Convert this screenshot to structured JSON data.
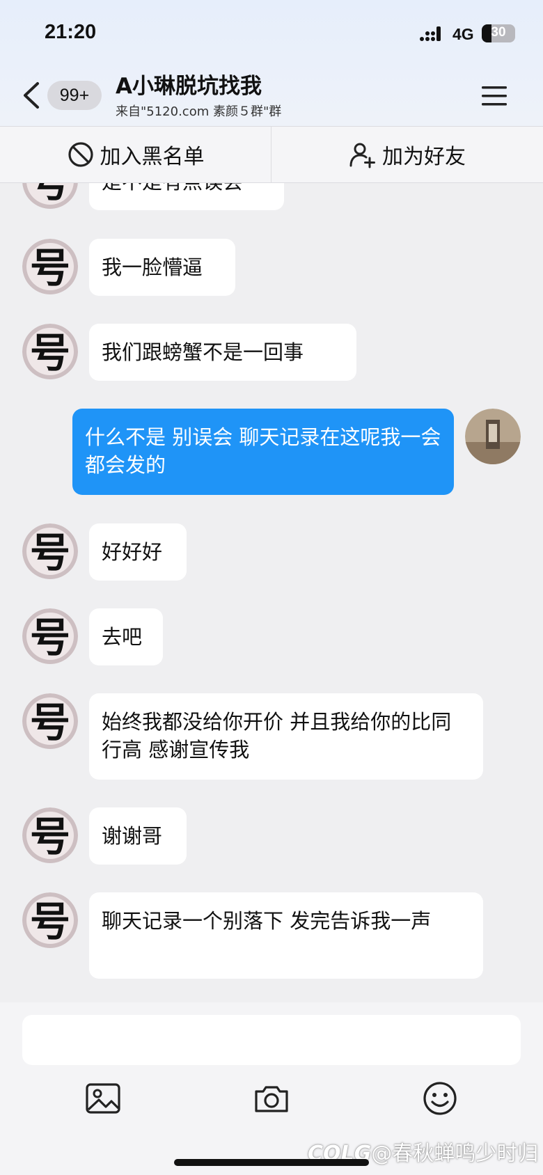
{
  "status_bar": {
    "time": "21:20",
    "network": "4G",
    "battery_level": "30",
    "battery_fraction": 0.3
  },
  "header": {
    "back_icon": "chevron-left-icon",
    "unread_count": "99+",
    "title": "A小琳脱坑找我",
    "subtitle": "来自\"5120.com 素颜５群\"群",
    "menu_icon": "hamburger-menu-icon"
  },
  "actions": {
    "blacklist_label": "加入黑名单",
    "blacklist_icon": "block-icon",
    "add_friend_label": "加为好友",
    "add_friend_icon": "add-user-icon"
  },
  "messages": [
    {
      "from": "other",
      "text": "是不是有点误会"
    },
    {
      "from": "other",
      "text": "我一脸懵逼"
    },
    {
      "from": "other",
      "text": "我们跟螃蟹不是一回事"
    },
    {
      "from": "self",
      "text": "什么不是 别误会 聊天记录在这呢我一会都会发的"
    },
    {
      "from": "other",
      "text": "好好好"
    },
    {
      "from": "other",
      "text": "去吧"
    },
    {
      "from": "other",
      "text": "始终我都没给你开价 并且我给你的比同行高 感谢宣传我"
    },
    {
      "from": "other",
      "text": "谢谢哥"
    },
    {
      "from": "other",
      "text": "聊天记录一个别落下 发完告诉我一声"
    }
  ],
  "avatar_glyph": "号",
  "input": {
    "value": "",
    "placeholder": ""
  },
  "toolbar": {
    "image_icon": "image-icon",
    "camera_icon": "camera-icon",
    "emoji_icon": "emoji-icon"
  },
  "watermark": "@春秋蝉鸣少时归",
  "watermark_logo": "COLG",
  "colors": {
    "self_bubble": "#1f94f7",
    "background": "#efeff1"
  }
}
